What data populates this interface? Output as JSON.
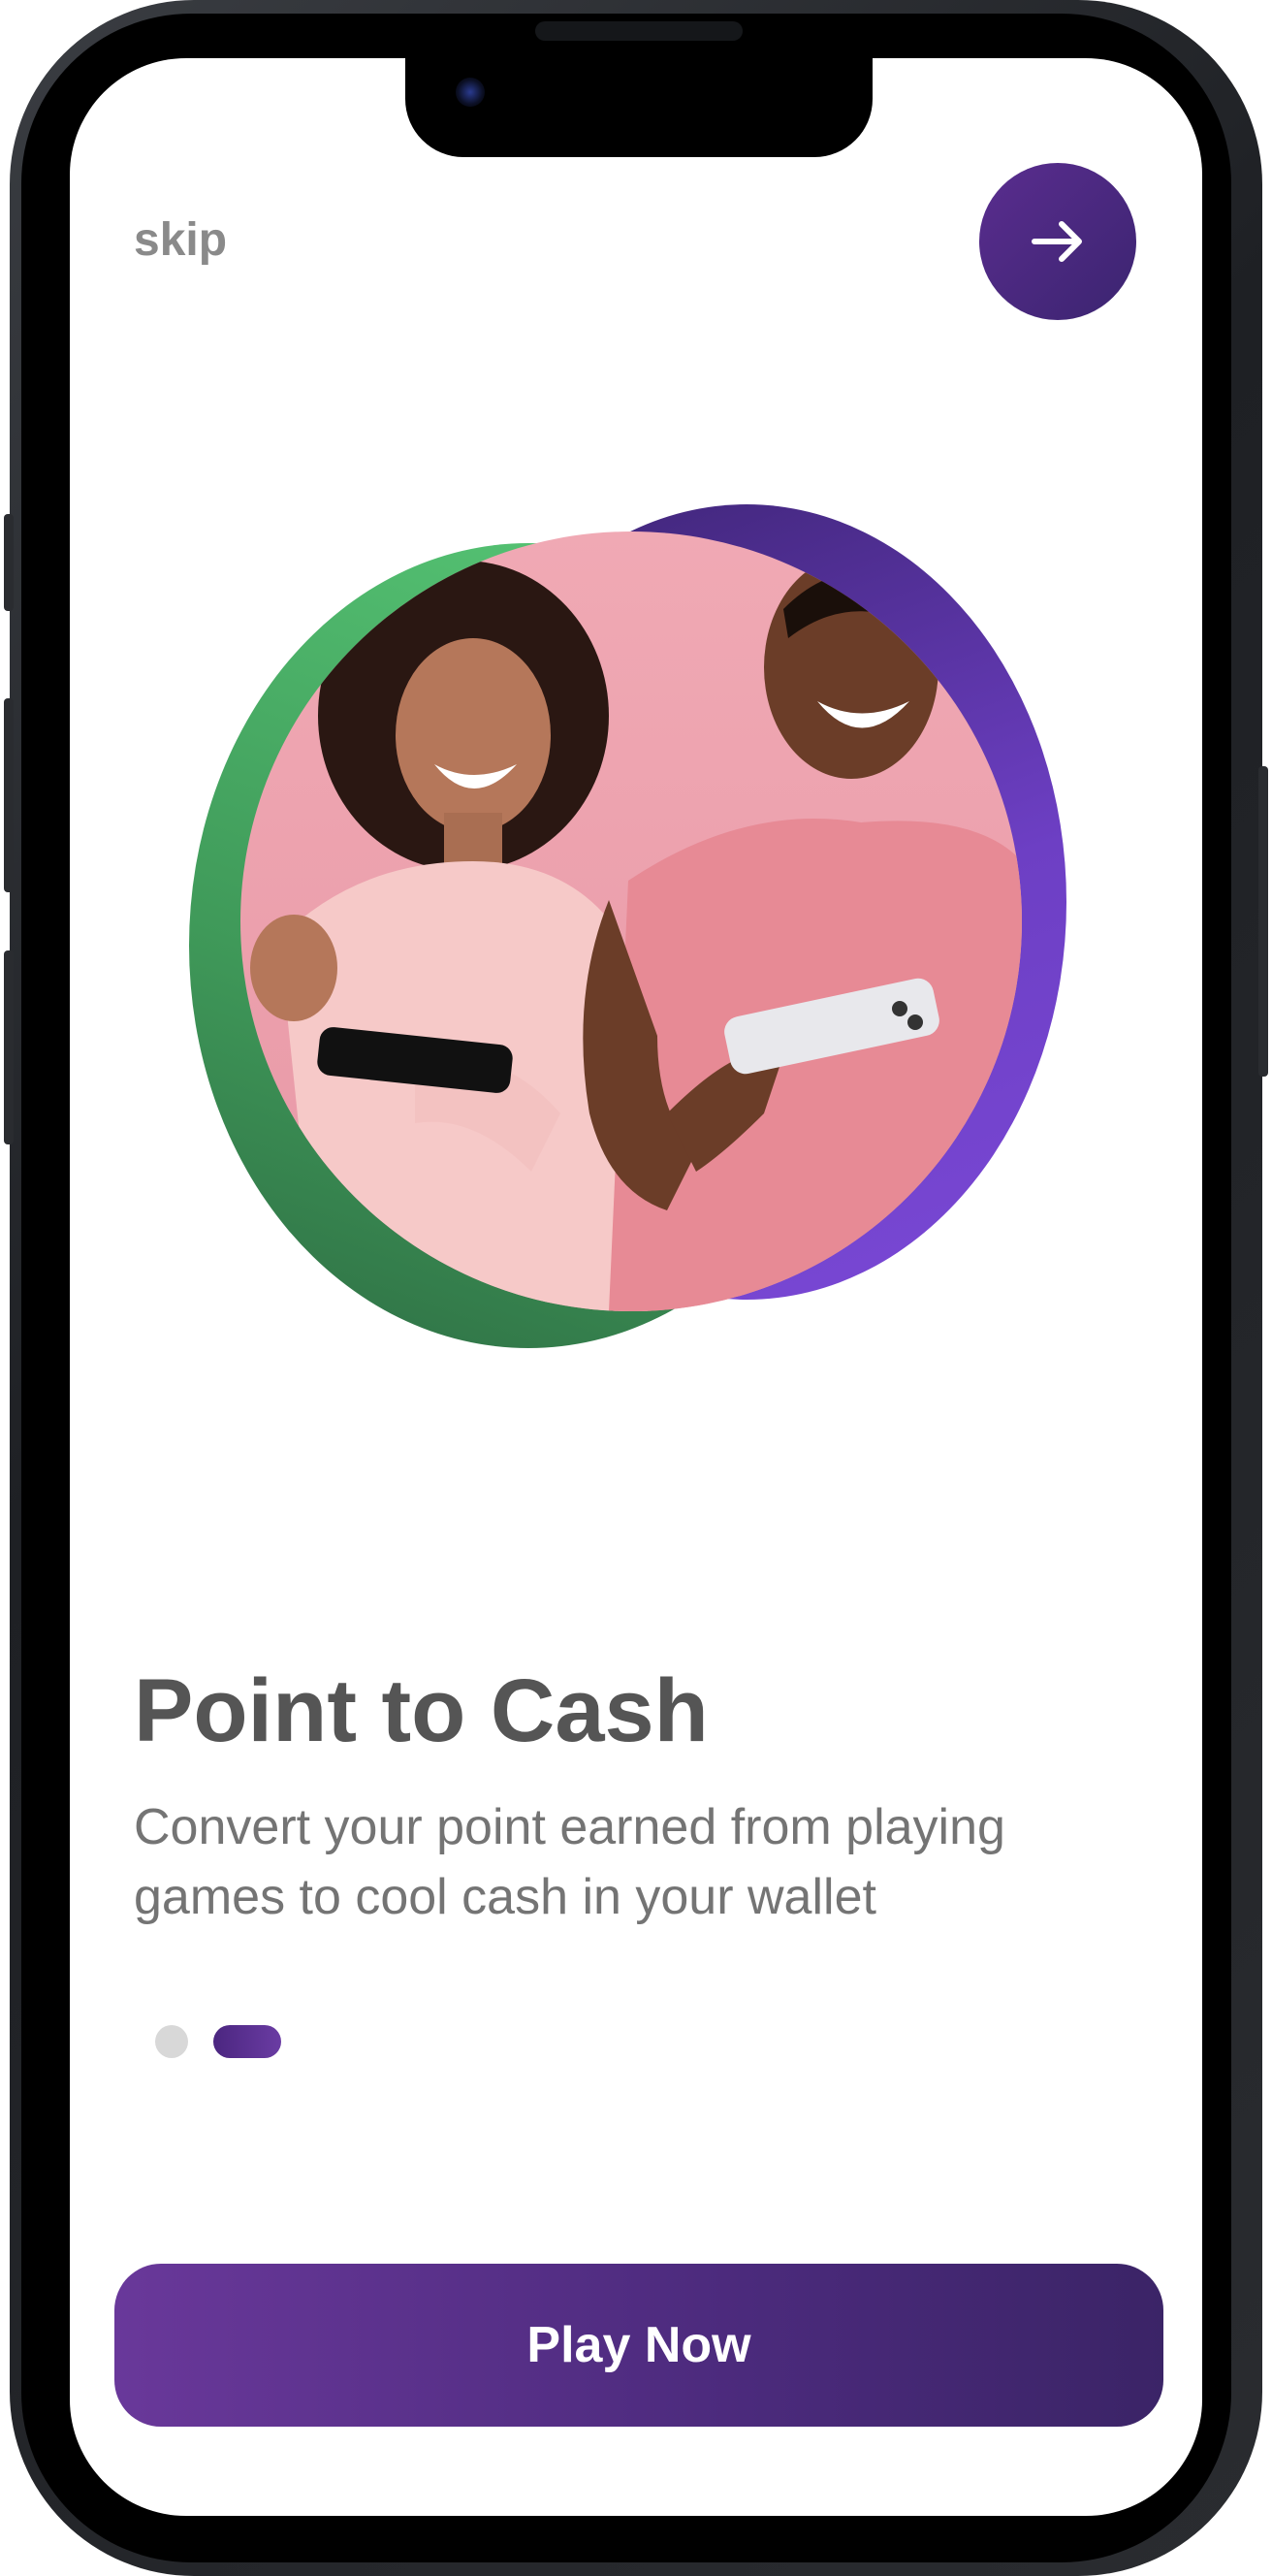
{
  "header": {
    "skip_label": "skip",
    "next_icon": "arrow-right-icon"
  },
  "hero": {
    "image": "two-people-laughing-holding-phones"
  },
  "onboarding": {
    "title": "Point to Cash",
    "description": "Convert your point earned from playing games to cool cash in your wallet",
    "page_indicator": {
      "total": 2,
      "active": 2
    }
  },
  "cta": {
    "label": "Play Now"
  },
  "colors": {
    "primary": "#4b2a7c",
    "accent_green": "#58c977",
    "text_dark": "#555555",
    "text_muted": "#747474"
  }
}
